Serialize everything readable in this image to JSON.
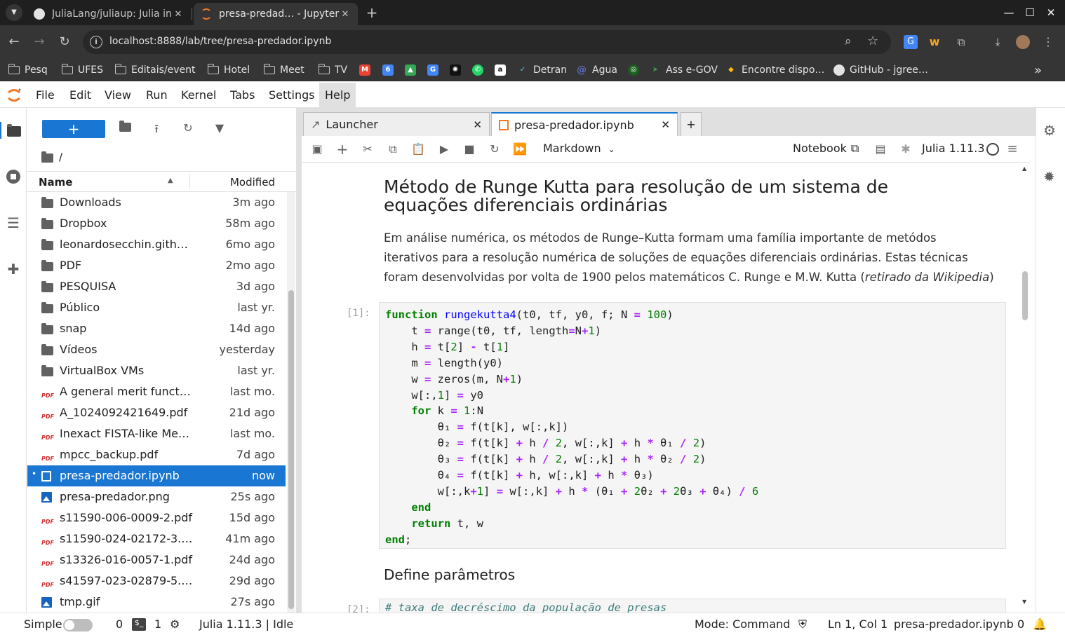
{
  "browser": {
    "tabs": [
      {
        "title": "JuliaLang/juliaup: Julia in",
        "close": "✕"
      },
      {
        "title": "presa-predad… - Jupyter",
        "close": "✕"
      }
    ],
    "url": "localhost:8888/lab/tree/presa-predador.ipynb",
    "bookmarks": [
      "Pesq",
      "UFES",
      "Editais/event",
      "Hotel",
      "Meet",
      "TV",
      "Detran",
      "Agua",
      "Ass e-GOV",
      "Encontre dispo…",
      "GitHub - jgree…"
    ]
  },
  "menubar": {
    "items": [
      "File",
      "Edit",
      "View",
      "Run",
      "Kernel",
      "Tabs",
      "Settings",
      "Help"
    ]
  },
  "filebrowser": {
    "path": "/",
    "col_name": "Name",
    "col_modified": "Modified",
    "files": [
      {
        "name": "Downloads",
        "modified": "3m ago",
        "type": "folder"
      },
      {
        "name": "Dropbox",
        "modified": "58m ago",
        "type": "folder"
      },
      {
        "name": "leonardosecchin.githu…",
        "modified": "6mo ago",
        "type": "folder"
      },
      {
        "name": "PDF",
        "modified": "2mo ago",
        "type": "folder"
      },
      {
        "name": "PESQUISA",
        "modified": "3d ago",
        "type": "folder"
      },
      {
        "name": "Público",
        "modified": "last yr.",
        "type": "folder"
      },
      {
        "name": "snap",
        "modified": "14d ago",
        "type": "folder"
      },
      {
        "name": "Vídeos",
        "modified": "yesterday",
        "type": "folder"
      },
      {
        "name": "VirtualBox VMs",
        "modified": "last yr.",
        "type": "folder"
      },
      {
        "name": "A general merit functio…",
        "modified": "last mo.",
        "type": "pdf"
      },
      {
        "name": "A_1024092421649.pdf",
        "modified": "21d ago",
        "type": "pdf"
      },
      {
        "name": "Inexact FISTA-like Meth…",
        "modified": "last mo.",
        "type": "pdf"
      },
      {
        "name": "mpcc_backup.pdf",
        "modified": "7d ago",
        "type": "pdf"
      },
      {
        "name": "presa-predador.ipynb",
        "modified": "now",
        "type": "notebook"
      },
      {
        "name": "presa-predador.png",
        "modified": "25s ago",
        "type": "image"
      },
      {
        "name": "s11590-006-0009-2.pdf",
        "modified": "15d ago",
        "type": "pdf"
      },
      {
        "name": "s11590-024-02172-3.pdf",
        "modified": "41m ago",
        "type": "pdf"
      },
      {
        "name": "s13326-016-0057-1.pdf",
        "modified": "24d ago",
        "type": "pdf"
      },
      {
        "name": "s41597-023-02879-5.pdf",
        "modified": "29d ago",
        "type": "pdf"
      },
      {
        "name": "tmp.gif",
        "modified": "27s ago",
        "type": "image"
      }
    ]
  },
  "dock": {
    "tabs": [
      "Launcher",
      "presa-predador.ipynb"
    ]
  },
  "toolbar": {
    "cell_type": "Markdown",
    "notebook": "Notebook",
    "kernel": "Julia 1.11.3"
  },
  "notebook": {
    "heading": "Método de Runge Kutta para resolução de um sistema de equações diferenciais ordinárias",
    "para_main": "Em análise numérica, os métodos de Runge–Kutta formam uma família importante de metódos iterativos para a resolução numérica de soluções de equações diferenciais ordinárias. Estas técnicas foram desenvolvidas por volta de 1900 pelos matemáticos C. Runge e M.W. Kutta (",
    "para_italic": "retirado da Wikipedia",
    "para_end": ")",
    "prompt1": "[1]:",
    "heading2": "Define parâmetros",
    "prompt2": "[2]:",
    "code2": "# taxa de decréscimo da população de presas"
  },
  "status": {
    "simple": "Simple",
    "terminals": "0",
    "kernels": "1",
    "kernel_status": "Julia 1.11.3 | Idle",
    "mode": "Mode: Command",
    "cursor": "Ln 1, Col 1",
    "file": "presa-predador.ipynb",
    "notifications": "0"
  }
}
